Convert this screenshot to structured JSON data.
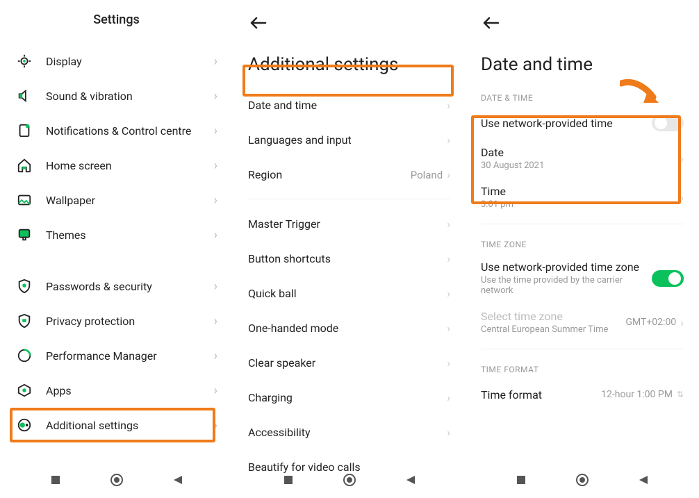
{
  "panel1": {
    "title": "Settings",
    "items": [
      {
        "label": "Display"
      },
      {
        "label": "Sound & vibration"
      },
      {
        "label": "Notifications & Control centre"
      },
      {
        "label": "Home screen"
      },
      {
        "label": "Wallpaper"
      },
      {
        "label": "Themes"
      }
    ],
    "items2": [
      {
        "label": "Passwords & security"
      },
      {
        "label": "Privacy protection"
      },
      {
        "label": "Performance Manager"
      },
      {
        "label": "Apps"
      },
      {
        "label": "Additional settings"
      }
    ]
  },
  "panel2": {
    "title": "Additional settings",
    "group1": [
      {
        "label": "Date and time",
        "value": ""
      },
      {
        "label": "Languages and input",
        "value": ""
      },
      {
        "label": "Region",
        "value": "Poland"
      }
    ],
    "group2": [
      {
        "label": "Master Trigger"
      },
      {
        "label": "Button shortcuts"
      },
      {
        "label": "Quick ball"
      },
      {
        "label": "One-handed mode"
      },
      {
        "label": "Clear speaker"
      },
      {
        "label": "Charging"
      },
      {
        "label": "Accessibility"
      },
      {
        "label": "Beautify for video calls"
      }
    ]
  },
  "panel3": {
    "title": "Date and time",
    "section_datetime": "DATE & TIME",
    "use_network_time": "Use network-provided time",
    "date_label": "Date",
    "date_value": "30 August 2021",
    "time_label": "Time",
    "time_value": "3:01 pm",
    "section_timezone": "TIME ZONE",
    "use_network_tz": "Use network-provided time zone",
    "use_network_tz_sub": "Use the time provided by the carrier network",
    "select_tz": "Select time zone",
    "select_tz_sub": "Central European Summer Time",
    "select_tz_value": "GMT+02:00",
    "section_format": "TIME FORMAT",
    "time_format": "Time format",
    "time_format_value": "12-hour 1:00 PM"
  }
}
